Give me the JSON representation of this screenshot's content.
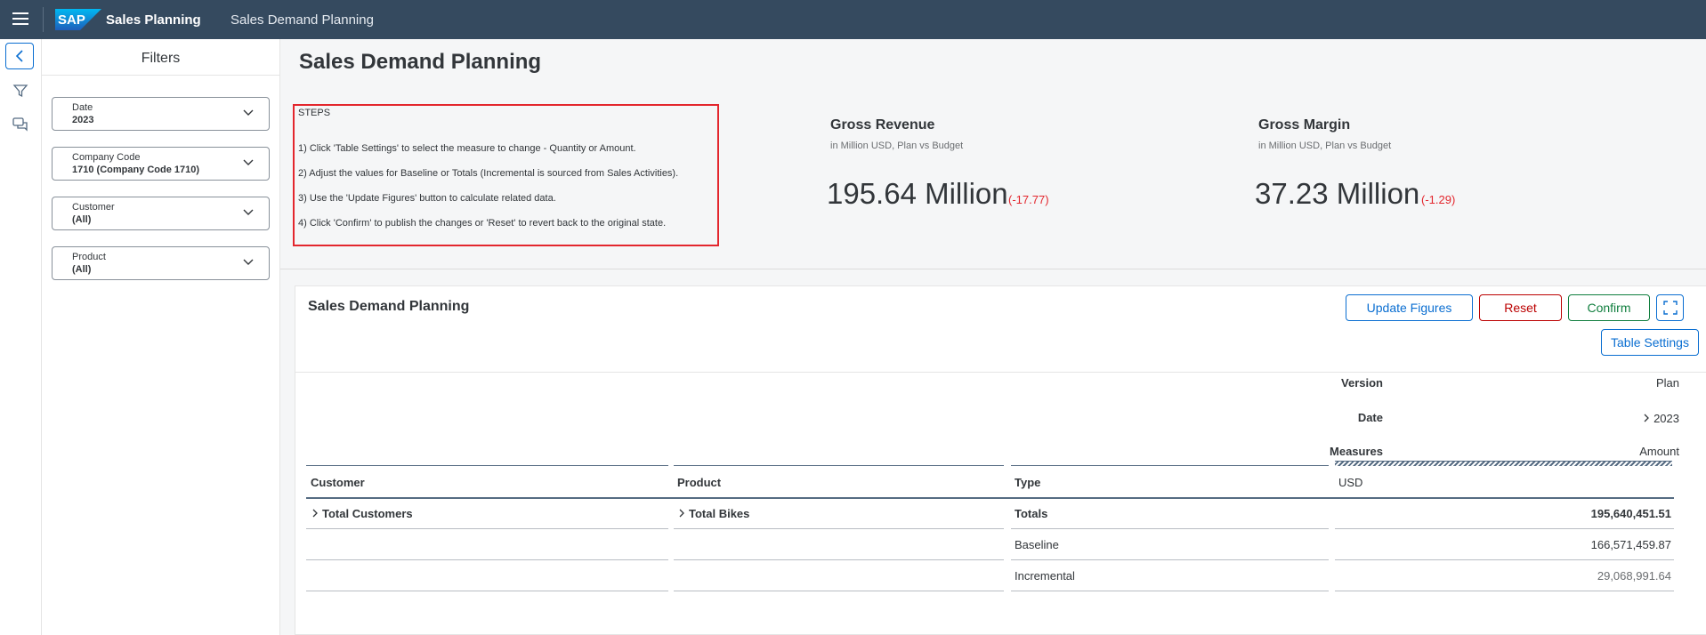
{
  "shell": {
    "app_title": "Sales Planning",
    "page_subtitle": "Sales Demand Planning",
    "logo_text": "SAP",
    "menu_icon": "hamburger-icon"
  },
  "rail": {
    "back_icon": "chevron-left-icon",
    "filter_icon": "funnel-icon",
    "comments_icon": "comments-icon"
  },
  "filters": {
    "title": "Filters",
    "items": [
      {
        "label": "Date",
        "value": "2023"
      },
      {
        "label": "Company Code",
        "value": "1710 (Company Code 1710)"
      },
      {
        "label": "Customer",
        "value": "(All)"
      },
      {
        "label": "Product",
        "value": "(All)"
      }
    ]
  },
  "main": {
    "title": "Sales Demand Planning",
    "steps": {
      "title": "STEPS",
      "items": [
        "1) Click 'Table Settings' to select the measure to change - Quantity or Amount.",
        "2) Adjust the values for Baseline or Totals (Incremental is sourced from Sales Activities).",
        "3) Use the 'Update Figures' button to calculate related data.",
        "4) Click 'Confirm' to publish the changes or 'Reset' to revert back to the original state."
      ]
    },
    "kpis": [
      {
        "title": "Gross Revenue",
        "subtitle": "in Million USD, Plan vs Budget",
        "value": "195.64 Million",
        "delta": "(-17.77)"
      },
      {
        "title": "Gross Margin",
        "subtitle": "in Million USD, Plan vs Budget",
        "value": "37.23 Million",
        "delta": "(-1.29)"
      }
    ]
  },
  "table_card": {
    "title": "Sales Demand Planning",
    "buttons": {
      "update": "Update Figures",
      "reset": "Reset",
      "confirm": "Confirm",
      "settings": "Table Settings"
    },
    "fullscreen_icon": "fullscreen-icon",
    "header_rows": [
      {
        "label": "Version",
        "value": "Plan"
      },
      {
        "label": "Date",
        "value": "2023"
      },
      {
        "label": "Measures",
        "value": "Amount"
      }
    ],
    "columns": [
      "Customer",
      "Product",
      "Type",
      "USD"
    ],
    "rows": [
      {
        "customer": "Total Customers",
        "product": "Total Bikes",
        "type": "Totals",
        "value": "195,640,451.51"
      },
      {
        "customer": "",
        "product": "",
        "type": "Baseline",
        "value": "166,571,459.87"
      },
      {
        "customer": "",
        "product": "",
        "type": "Incremental",
        "value": "29,068,991.64"
      }
    ]
  }
}
